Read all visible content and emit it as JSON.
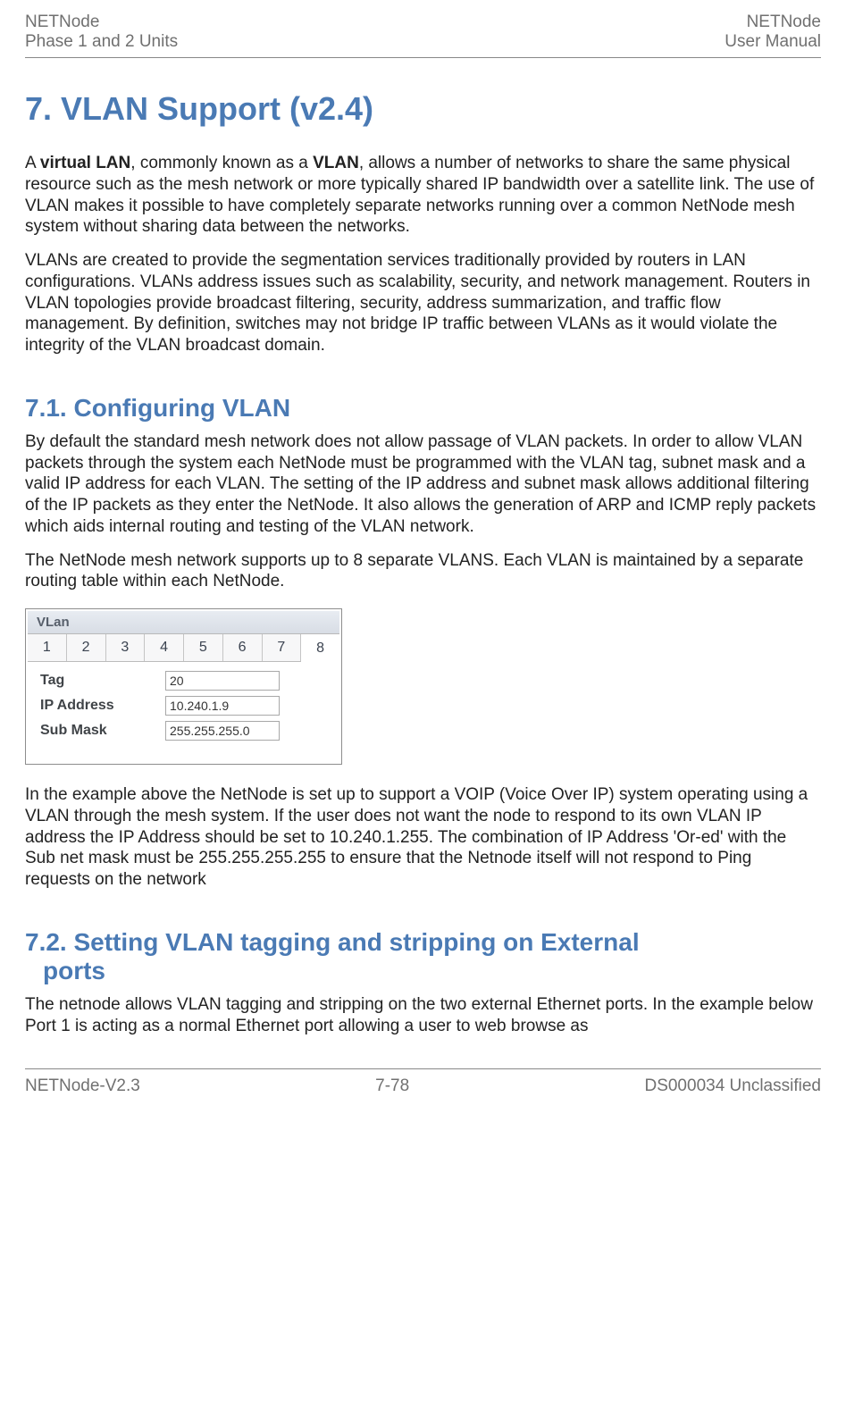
{
  "header": {
    "left_line1": "NETNode",
    "left_line2": "Phase 1 and 2 Units",
    "right_line1": "NETNode",
    "right_line2": "User Manual"
  },
  "title": "7. VLAN Support (v2.4)",
  "para1_prefix": "A ",
  "para1_bold1": "virtual LAN",
  "para1_mid": ", commonly known as a ",
  "para1_bold2": "VLAN",
  "para1_suffix": ", allows a number of networks to share the same physical resource such as the mesh network or more typically shared IP bandwidth over a satellite link. The use of VLAN makes it possible to have completely separate networks running over a common NetNode mesh system without sharing data between the networks.",
  "para2": "VLANs are created to provide the segmentation services traditionally provided by routers in LAN configurations. VLANs address issues such as scalability, security, and network management. Routers in VLAN topologies provide broadcast filtering, security, address summarization, and traffic flow management. By definition, switches may not bridge IP traffic between VLANs as it would violate the integrity of the VLAN broadcast domain.",
  "section_71": "7.1.  Configuring VLAN",
  "para3": "By default the standard mesh network does not allow passage of VLAN packets. In order to allow VLAN packets through the system each NetNode must be programmed with the VLAN tag, subnet mask and a valid IP address for each VLAN. The setting of the IP address and subnet mask allows additional filtering of the IP packets as they enter the NetNode. It also allows the generation of ARP and ICMP reply packets which aids internal routing and testing of the VLAN network.",
  "para4": "The NetNode mesh network supports up to 8 separate VLANS. Each VLAN is maintained by a separate routing table within each NetNode.",
  "vlan_panel": {
    "title": "VLan",
    "tabs": [
      "1",
      "2",
      "3",
      "4",
      "5",
      "6",
      "7",
      "8"
    ],
    "active_index": 7,
    "rows": {
      "tag_label": "Tag",
      "tag_value": "20",
      "ip_label": "IP Address",
      "ip_value": "10.240.1.9",
      "mask_label": "Sub Mask",
      "mask_value": "255.255.255.0"
    }
  },
  "para5": "In the example above the NetNode is set up to support a VOIP (Voice Over IP) system operating using a VLAN through the mesh system. If the user does not want the node to respond to its own VLAN IP address the IP Address should be set to 10.240.1.255. The combination of IP Address 'Or-ed' with the Sub net mask must be 255.255.255.255 to ensure that the Netnode itself will not respond to Ping requests on the network",
  "section_72_line1": "7.2.  Setting VLAN tagging and stripping on External",
  "section_72_line2": "ports",
  "para6": "The netnode allows VLAN tagging and stripping on the two external Ethernet ports. In the example below Port 1 is acting as a normal Ethernet port allowing a user to web browse as",
  "footer": {
    "left": "NETNode-V2.3",
    "center": "7-78",
    "right": "DS000034 Unclassified"
  }
}
